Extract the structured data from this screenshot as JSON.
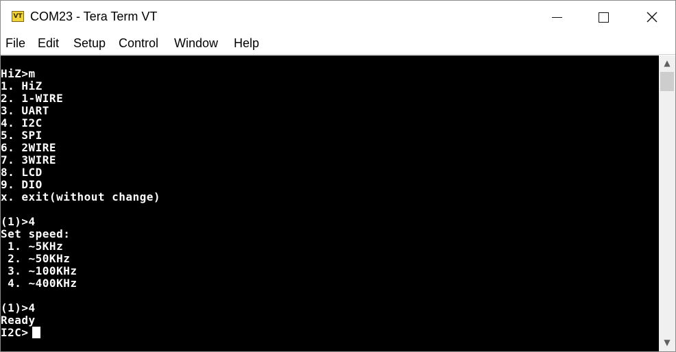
{
  "window": {
    "title": "COM23 - Tera Term VT",
    "icon_label": "VT",
    "icon_name": "teraterm-vt-icon"
  },
  "menu": {
    "items": [
      {
        "label": "File"
      },
      {
        "label": "Edit"
      },
      {
        "label": "Setup"
      },
      {
        "label": "Control"
      },
      {
        "label": "Window"
      },
      {
        "label": "Help"
      }
    ]
  },
  "terminal": {
    "lines": [
      "HiZ>m",
      "1. HiZ",
      "2. 1-WIRE",
      "3. UART",
      "4. I2C",
      "5. SPI",
      "6. 2WIRE",
      "7. 3WIRE",
      "8. LCD",
      "9. DIO",
      "x. exit(without change)",
      "",
      "(1)>4",
      "Set speed:",
      " 1. ~5KHz",
      " 2. ~50KHz",
      " 3. ~100KHz",
      " 4. ~400KHz",
      "",
      "(1)>4",
      "Ready",
      "I2C>"
    ],
    "colors": {
      "background": "#000000",
      "foreground": "#ffffff"
    }
  }
}
